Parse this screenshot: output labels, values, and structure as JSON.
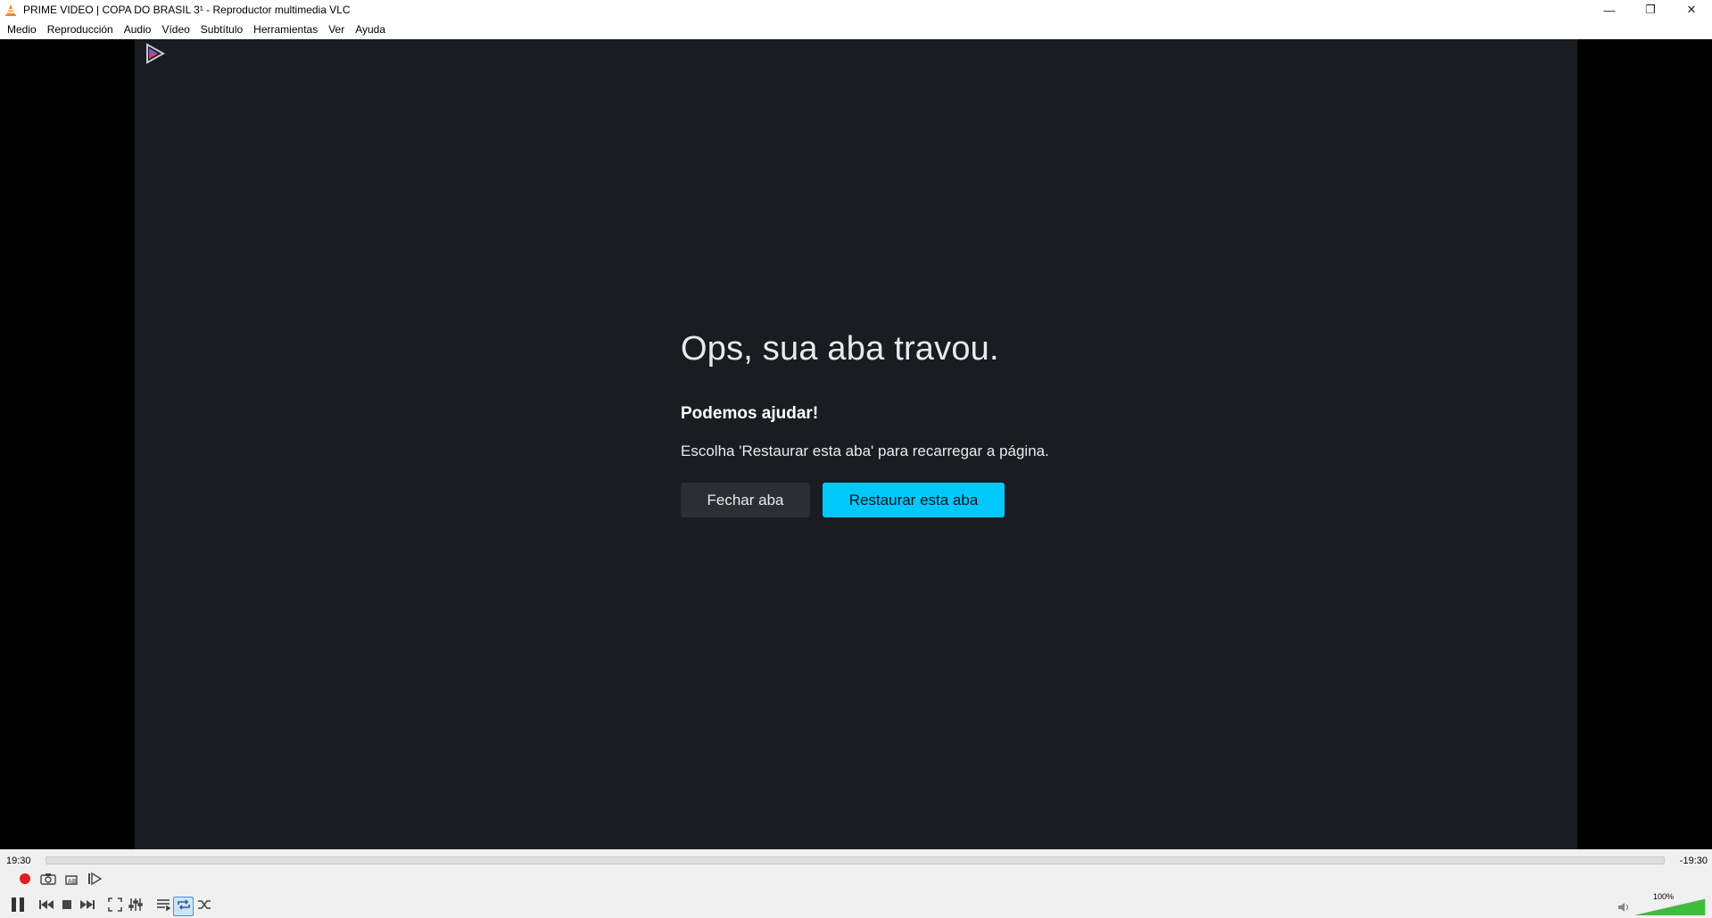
{
  "window": {
    "title": "PRIME VIDEO  | COPA DO BRASIL 3¹ - Reproductor multimedia VLC",
    "minimize": "—",
    "maximize": "❐",
    "close": "✕"
  },
  "menu": [
    "Medio",
    "Reproducción",
    "Audio",
    "Vídeo",
    "Subtítulo",
    "Herramientas",
    "Ver",
    "Ayuda"
  ],
  "page": {
    "title": "Ops, sua aba travou.",
    "subtitle": "Podemos ajudar!",
    "description": "Escolha 'Restaurar esta aba' para recarregar a página.",
    "close_button": "Fechar aba",
    "restore_button": "Restaurar esta aba"
  },
  "player": {
    "time_elapsed": "19:30",
    "time_remaining": "-19:30",
    "volume": "100%",
    "volume_level": 1.0,
    "accent": "#00c8f8"
  }
}
